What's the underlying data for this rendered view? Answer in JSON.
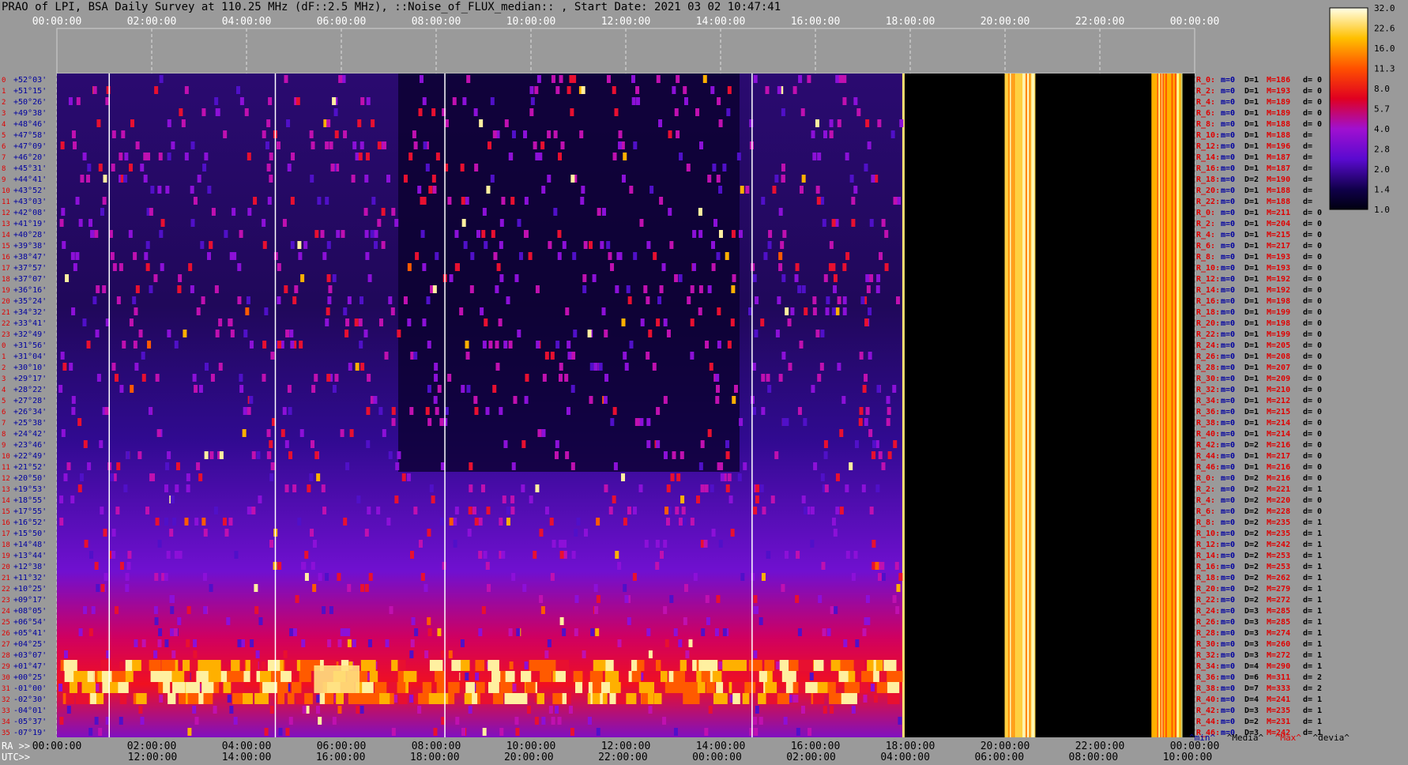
{
  "title": "PRAO of LPI, BSA Daily Survey at 110.25 MHz (dF::2.5 MHz), ::Noise_of_FLUX_median:: , Start Date: 2021 03 02 10:47:41",
  "chart_data": {
    "type": "heatmap",
    "title": "PRAO of LPI, BSA Daily Survey at 110.25 MHz (dF::2.5 MHz), ::Noise_of_FLUX_median:: , Start Date: 2021 03 02 10:47:41",
    "x_top_ticks": [
      "00:00:00",
      "02:00:00",
      "04:00:00",
      "06:00:00",
      "08:00:00",
      "10:00:00",
      "12:00:00",
      "14:00:00",
      "16:00:00",
      "18:00:00",
      "20:00:00",
      "22:00:00",
      "00:00:00"
    ],
    "x_bottom_ra_label": "RA >>",
    "x_bottom_ra_ticks": [
      "00:00:00",
      "02:00:00",
      "04:00:00",
      "06:00:00",
      "08:00:00",
      "10:00:00",
      "12:00:00",
      "14:00:00",
      "16:00:00",
      "18:00:00",
      "20:00:00",
      "22:00:00",
      "00:00:00"
    ],
    "x_bottom_utc_label": "UTC>>",
    "x_bottom_utc_ticks": [
      "12:00:00",
      "14:00:00",
      "16:00:00",
      "18:00:00",
      "20:00:00",
      "22:00:00",
      "00:00:00",
      "02:00:00",
      "04:00:00",
      "06:00:00",
      "08:00:00",
      "10:00:00"
    ],
    "colorbar_ticks": [
      "32.0",
      "22.6",
      "16.0",
      "11.3",
      "8.0",
      "5.7",
      "4.0",
      "2.8",
      "2.0",
      "1.4",
      "1.0"
    ],
    "colorbar_range": [
      1.0,
      32.0
    ],
    "colorbar_scale": "log",
    "declinations": [
      "+52°03'",
      "+51°15'",
      "+50°26'",
      "+49°38'",
      "+48°46'",
      "+47°58'",
      "+47°09'",
      "+46°20'",
      "+45°31'",
      "+44°41'",
      "+43°52'",
      "+43°03'",
      "+42°08'",
      "+41°19'",
      "+40°28'",
      "+39°38'",
      "+38°47'",
      "+37°57'",
      "+37°07'",
      "+36°16'",
      "+35°24'",
      "+34°32'",
      "+33°41'",
      "+32°49'",
      "+31°56'",
      "+31°04'",
      "+30°10'",
      "+29°17'",
      "+28°22'",
      "+27°28'",
      "+26°34'",
      "+25°38'",
      "+24°42'",
      "+23°46'",
      "+22°49'",
      "+21°52'",
      "+20°50'",
      "+19°53'",
      "+18°55'",
      "+17°55'",
      "+16°52'",
      "+15°50'",
      "+14°48'",
      "+13°44'",
      "+12°38'",
      "+11°32'",
      "+10°25'",
      "+09°17'",
      "+08°05'",
      "+06°54'",
      "+05°41'",
      "+04°25'",
      "+03°07'",
      "+01°47'",
      "+00°25'",
      "-01°00'",
      "-02°30'",
      "-04°01'",
      "-05°37'",
      "-07°19'"
    ],
    "beam_numbers": [
      "0",
      "1",
      "2",
      "3",
      "4",
      "5",
      "6",
      "7",
      "8",
      "9",
      "10",
      "11",
      "12",
      "13",
      "14",
      "15",
      "16",
      "17",
      "18",
      "19",
      "20",
      "21",
      "22",
      "23",
      "0",
      "1",
      "2",
      "3",
      "4",
      "5",
      "6",
      "7",
      "8",
      "9",
      "10",
      "11",
      "12",
      "13",
      "14",
      "15",
      "16",
      "17",
      "18",
      "19",
      "20",
      "21",
      "22",
      "23",
      "24",
      "25",
      "26",
      "27",
      "28",
      "29",
      "30",
      "31",
      "32",
      "33",
      "34",
      "35"
    ],
    "beam_stats": [
      {
        "r": "R_0:",
        "m": "m=0",
        "D": "D=1",
        "M": "M=186",
        "d": "d= 0"
      },
      {
        "r": "R_2:",
        "m": "m=0",
        "D": "D=1",
        "M": "M=193",
        "d": "d= 0"
      },
      {
        "r": "R_4:",
        "m": "m=0",
        "D": "D=1",
        "M": "M=189",
        "d": "d= 0"
      },
      {
        "r": "R_6:",
        "m": "m=0",
        "D": "D=1",
        "M": "M=189",
        "d": "d= 0"
      },
      {
        "r": "R_8:",
        "m": "m=0",
        "D": "D=1",
        "M": "M=188",
        "d": "d= 0"
      },
      {
        "r": "R_10:",
        "m": "m=0",
        "D": "D=1",
        "M": "M=188",
        "d": "d="
      },
      {
        "r": "R_12:",
        "m": "m=0",
        "D": "D=1",
        "M": "M=196",
        "d": "d="
      },
      {
        "r": "R_14:",
        "m": "m=0",
        "D": "D=1",
        "M": "M=187",
        "d": "d="
      },
      {
        "r": "R_16:",
        "m": "m=0",
        "D": "D=1",
        "M": "M=187",
        "d": "d="
      },
      {
        "r": "R_18:",
        "m": "m=0",
        "D": "D=2",
        "M": "M=190",
        "d": "d="
      },
      {
        "r": "R_20:",
        "m": "m=0",
        "D": "D=1",
        "M": "M=188",
        "d": "d="
      },
      {
        "r": "R_22:",
        "m": "m=0",
        "D": "D=1",
        "M": "M=188",
        "d": "d="
      },
      {
        "r": "R_0:",
        "m": "m=0",
        "D": "D=1",
        "M": "M=211",
        "d": "d= 0"
      },
      {
        "r": "R_2:",
        "m": "m=0",
        "D": "D=1",
        "M": "M=204",
        "d": "d= 0"
      },
      {
        "r": "R_4:",
        "m": "m=0",
        "D": "D=1",
        "M": "M=215",
        "d": "d= 0"
      },
      {
        "r": "R_6:",
        "m": "m=0",
        "D": "D=1",
        "M": "M=217",
        "d": "d= 0"
      },
      {
        "r": "R_8:",
        "m": "m=0",
        "D": "D=1",
        "M": "M=193",
        "d": "d= 0"
      },
      {
        "r": "R_10:",
        "m": "m=0",
        "D": "D=1",
        "M": "M=193",
        "d": "d= 0"
      },
      {
        "r": "R_12:",
        "m": "m=0",
        "D": "D=1",
        "M": "M=192",
        "d": "d= 0"
      },
      {
        "r": "R_14:",
        "m": "m=0",
        "D": "D=1",
        "M": "M=192",
        "d": "d= 0"
      },
      {
        "r": "R_16:",
        "m": "m=0",
        "D": "D=1",
        "M": "M=198",
        "d": "d= 0"
      },
      {
        "r": "R_18:",
        "m": "m=0",
        "D": "D=1",
        "M": "M=199",
        "d": "d= 0"
      },
      {
        "r": "R_20:",
        "m": "m=0",
        "D": "D=1",
        "M": "M=198",
        "d": "d= 0"
      },
      {
        "r": "R_22:",
        "m": "m=0",
        "D": "D=1",
        "M": "M=199",
        "d": "d= 0"
      },
      {
        "r": "R_24:",
        "m": "m=0",
        "D": "D=1",
        "M": "M=205",
        "d": "d= 0"
      },
      {
        "r": "R_26:",
        "m": "m=0",
        "D": "D=1",
        "M": "M=208",
        "d": "d= 0"
      },
      {
        "r": "R_28:",
        "m": "m=0",
        "D": "D=1",
        "M": "M=207",
        "d": "d= 0"
      },
      {
        "r": "R_30:",
        "m": "m=0",
        "D": "D=1",
        "M": "M=209",
        "d": "d= 0"
      },
      {
        "r": "R_32:",
        "m": "m=0",
        "D": "D=1",
        "M": "M=210",
        "d": "d= 0"
      },
      {
        "r": "R_34:",
        "m": "m=0",
        "D": "D=1",
        "M": "M=212",
        "d": "d= 0"
      },
      {
        "r": "R_36:",
        "m": "m=0",
        "D": "D=1",
        "M": "M=215",
        "d": "d= 0"
      },
      {
        "r": "R_38:",
        "m": "m=0",
        "D": "D=1",
        "M": "M=214",
        "d": "d= 0"
      },
      {
        "r": "R_40:",
        "m": "m=0",
        "D": "D=1",
        "M": "M=214",
        "d": "d= 0"
      },
      {
        "r": "R_42:",
        "m": "m=0",
        "D": "D=2",
        "M": "M=216",
        "d": "d= 0"
      },
      {
        "r": "R_44:",
        "m": "m=0",
        "D": "D=1",
        "M": "M=217",
        "d": "d= 0"
      },
      {
        "r": "R_46:",
        "m": "m=0",
        "D": "D=1",
        "M": "M=216",
        "d": "d= 0"
      },
      {
        "r": "R_0:",
        "m": "m=0",
        "D": "D=2",
        "M": "M=216",
        "d": "d= 0"
      },
      {
        "r": "R_2:",
        "m": "m=0",
        "D": "D=2",
        "M": "M=221",
        "d": "d= 1"
      },
      {
        "r": "R_4:",
        "m": "m=0",
        "D": "D=2",
        "M": "M=220",
        "d": "d= 0"
      },
      {
        "r": "R_6:",
        "m": "m=0",
        "D": "D=2",
        "M": "M=228",
        "d": "d= 0"
      },
      {
        "r": "R_8:",
        "m": "m=0",
        "D": "D=2",
        "M": "M=235",
        "d": "d= 1"
      },
      {
        "r": "R_10:",
        "m": "m=0",
        "D": "D=2",
        "M": "M=235",
        "d": "d= 1"
      },
      {
        "r": "R_12:",
        "m": "m=0",
        "D": "D=2",
        "M": "M=242",
        "d": "d= 1"
      },
      {
        "r": "R_14:",
        "m": "m=0",
        "D": "D=2",
        "M": "M=253",
        "d": "d= 1"
      },
      {
        "r": "R_16:",
        "m": "m=0",
        "D": "D=2",
        "M": "M=253",
        "d": "d= 1"
      },
      {
        "r": "R_18:",
        "m": "m=0",
        "D": "D=2",
        "M": "M=262",
        "d": "d= 1"
      },
      {
        "r": "R_20:",
        "m": "m=0",
        "D": "D=2",
        "M": "M=279",
        "d": "d= 1"
      },
      {
        "r": "R_22:",
        "m": "m=0",
        "D": "D=2",
        "M": "M=272",
        "d": "d= 1"
      },
      {
        "r": "R_24:",
        "m": "m=0",
        "D": "D=3",
        "M": "M=285",
        "d": "d= 1"
      },
      {
        "r": "R_26:",
        "m": "m=0",
        "D": "D=3",
        "M": "M=285",
        "d": "d= 1"
      },
      {
        "r": "R_28:",
        "m": "m=0",
        "D": "D=3",
        "M": "M=274",
        "d": "d= 1"
      },
      {
        "r": "R_30:",
        "m": "m=0",
        "D": "D=3",
        "M": "M=260",
        "d": "d= 1"
      },
      {
        "r": "R_32:",
        "m": "m=0",
        "D": "D=3",
        "M": "M=272",
        "d": "d= 1"
      },
      {
        "r": "R_34:",
        "m": "m=0",
        "D": "D=4",
        "M": "M=290",
        "d": "d= 1"
      },
      {
        "r": "R_36:",
        "m": "m=0",
        "D": "D=6",
        "M": "M=311",
        "d": "d= 2"
      },
      {
        "r": "R_38:",
        "m": "m=0",
        "D": "D=7",
        "M": "M=333",
        "d": "d= 2"
      },
      {
        "r": "R_40:",
        "m": "m=0",
        "D": "D=4",
        "M": "M=241",
        "d": "d= 1"
      },
      {
        "r": "R_42:",
        "m": "m=0",
        "D": "D=3",
        "M": "M=235",
        "d": "d= 1"
      },
      {
        "r": "R_44:",
        "m": "m=0",
        "D": "D=2",
        "M": "M=231",
        "d": "d= 1"
      },
      {
        "r": "R_46:",
        "m": "m=0",
        "D": "D=3",
        "M": "M=242",
        "d": "d= 1"
      }
    ],
    "legend": [
      "^min^",
      "^Media^",
      "^Max^",
      "^devia^"
    ],
    "colors": {
      "background": "#9a9a9a",
      "label_red": "#e00000",
      "label_blue": "#0000a0"
    }
  }
}
